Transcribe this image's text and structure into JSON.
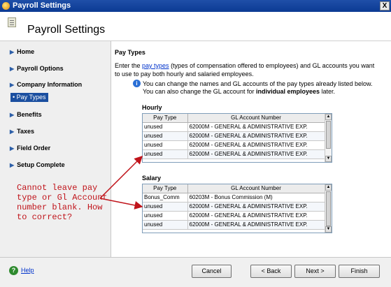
{
  "window": {
    "title": "Payroll Settings",
    "close_label": "X"
  },
  "header": {
    "title": "Payroll Settings"
  },
  "sidebar": {
    "items": [
      {
        "label": "Home"
      },
      {
        "label": "Payroll Options"
      },
      {
        "label": "Company Information"
      },
      {
        "label": "Benefits"
      },
      {
        "label": "Taxes"
      },
      {
        "label": "Field Order"
      },
      {
        "label": "Setup Complete"
      }
    ],
    "subitem": {
      "label": "Pay Types"
    }
  },
  "main": {
    "section_title": "Pay Types",
    "intro_before_link": "Enter the ",
    "intro_link": "pay types",
    "intro_after_link": " (types of compensation offered to employees) and GL accounts you want to use to pay both hourly and salaried employees.",
    "info_text": "You can change the names and GL accounts of the pay types already listed below. You can also change the GL account for ",
    "info_bold": "individual employees",
    "info_tail": " later."
  },
  "hourly": {
    "label": "Hourly",
    "columns": [
      "Pay Type",
      "GL Account Number"
    ],
    "rows": [
      [
        "unused",
        "62000M - GENERAL & ADMINISTRATIVE EXP."
      ],
      [
        "unused",
        "62000M - GENERAL & ADMINISTRATIVE EXP."
      ],
      [
        "unused",
        "62000M - GENERAL & ADMINISTRATIVE EXP."
      ],
      [
        "unused",
        "62000M - GENERAL & ADMINISTRATIVE EXP."
      ]
    ]
  },
  "salary": {
    "label": "Salary",
    "columns": [
      "Pay Type",
      "GL Account Number"
    ],
    "rows": [
      [
        "Bonus_Comm",
        "60203M - Bonus Commission (M)"
      ],
      [
        "unused",
        "62000M - GENERAL & ADMINISTRATIVE EXP."
      ],
      [
        "unused",
        "62000M - GENERAL & ADMINISTRATIVE EXP."
      ],
      [
        "unused",
        "62000M - GENERAL & ADMINISTRATIVE EXP."
      ]
    ]
  },
  "annotation": {
    "text": "Cannot leave pay type or Gl Account number blank. How to correct?",
    "color": "#c0141b"
  },
  "footer": {
    "help": "Help",
    "cancel": "Cancel",
    "back": "< Back",
    "next": "Next >",
    "finish": "Finish"
  },
  "colors": {
    "titlebar": "#0b3a93",
    "link": "#0033cc",
    "selected_nav": "#1b4fa0"
  }
}
